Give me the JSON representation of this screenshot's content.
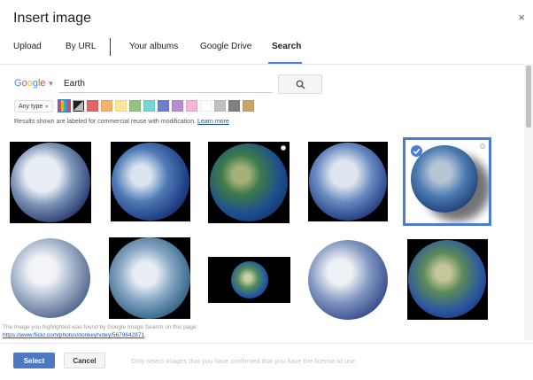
{
  "dialog": {
    "title": "Insert image",
    "close_glyph": "×"
  },
  "tabs": [
    {
      "label": "Upload",
      "active": false
    },
    {
      "label": "By URL",
      "active": false
    },
    {
      "label": "Your albums",
      "active": false
    },
    {
      "label": "Google Drive",
      "active": false
    },
    {
      "label": "Search",
      "active": true
    }
  ],
  "search": {
    "provider": "Google",
    "query": "Earth",
    "button_icon": "magnifier-icon"
  },
  "filters": {
    "type_label": "Any type",
    "color_swatches": [
      "multicolor",
      "#7f7f7f",
      "#e06666",
      "#f6b26b",
      "#ffe599",
      "#93c47d",
      "#76d7d7",
      "#6d7fcf",
      "#b48ed1",
      "#f4b6d6",
      "#ffffff",
      "#c0c0c0",
      "#808080",
      "#c9a56a"
    ]
  },
  "notice": {
    "text": "Results shown are labeled for commercial reuse with modification.",
    "link": "Learn more"
  },
  "results": [
    {
      "name": "earth-1",
      "selected": false
    },
    {
      "name": "earth-2",
      "selected": false
    },
    {
      "name": "earth-3",
      "selected": false
    },
    {
      "name": "earth-4",
      "selected": false
    },
    {
      "name": "earth-5",
      "selected": true
    },
    {
      "name": "earth-6",
      "selected": false
    },
    {
      "name": "earth-7",
      "selected": false
    },
    {
      "name": "earth-8",
      "selected": false
    },
    {
      "name": "earth-9",
      "selected": false
    },
    {
      "name": "earth-10",
      "selected": false
    }
  ],
  "source": {
    "text": "The image you highlighted was found by Google Image Search on this page:",
    "url": "https://www.flickr.com/photos/donkeyhotey/5679642871"
  },
  "footer": {
    "select_label": "Select",
    "cancel_label": "Cancel",
    "note": "Only select images that you have confirmed that you have the license to use."
  },
  "colors": {
    "accent": "#4a7bd9",
    "select_button": "#4d79c2"
  }
}
